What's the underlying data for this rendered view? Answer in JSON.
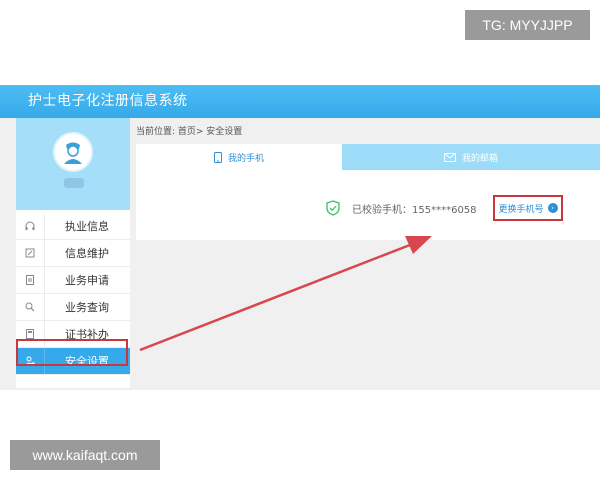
{
  "watermarks": {
    "top": "TG: MYYJJPP",
    "bottom": "www.kaifaqt.com"
  },
  "header": {
    "title": "护士电子化注册信息系统"
  },
  "sidebar": {
    "items": [
      {
        "label": "执业信息",
        "icon": "headset-icon"
      },
      {
        "label": "信息维护",
        "icon": "edit-icon"
      },
      {
        "label": "业务申请",
        "icon": "document-icon"
      },
      {
        "label": "业务查询",
        "icon": "search-icon"
      },
      {
        "label": "证书补办",
        "icon": "certificate-icon"
      },
      {
        "label": "安全设置",
        "icon": "user-lock-icon",
        "active": true
      }
    ]
  },
  "breadcrumb": {
    "text": "当前位置: 首页> 安全设置"
  },
  "tabs": {
    "phone": "我的手机",
    "email": "我的邮箱"
  },
  "security": {
    "verified_text": "已校验手机：155****6058",
    "change_button": "更换手机号"
  },
  "colors": {
    "primary": "#36a9ea",
    "highlight": "#c8373d",
    "tab_inactive": "#9ddcf8"
  }
}
